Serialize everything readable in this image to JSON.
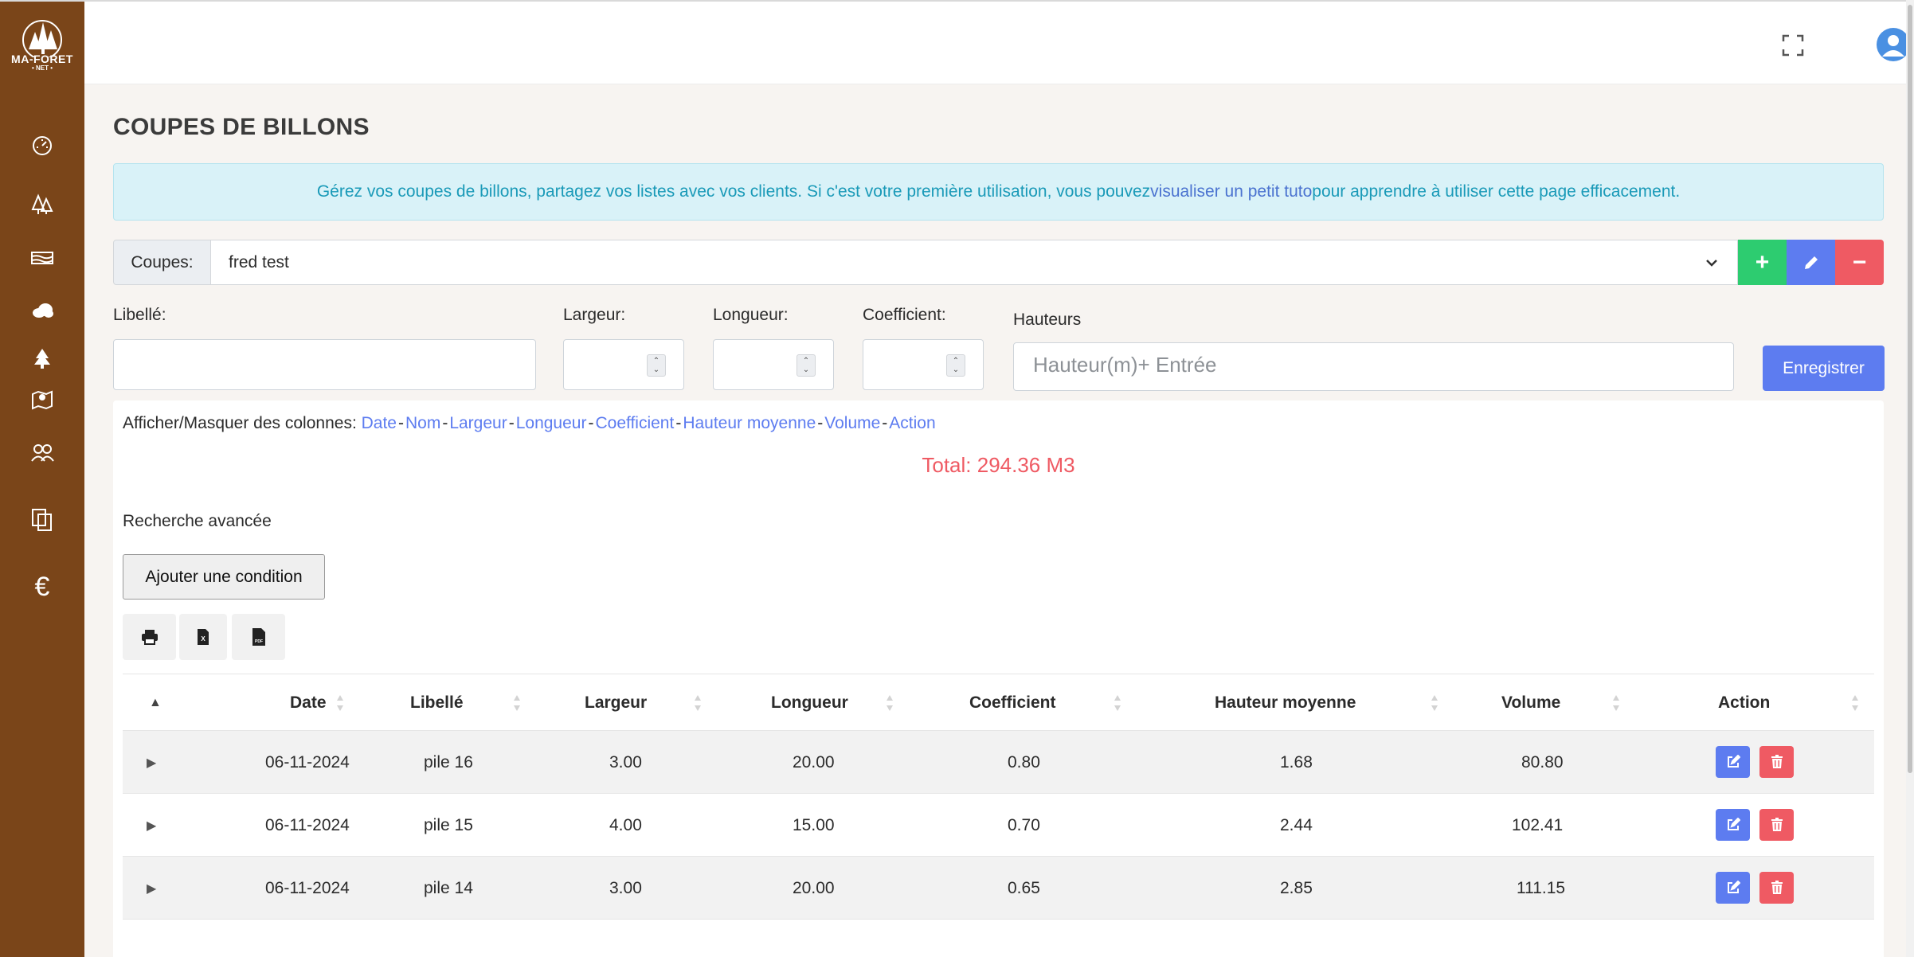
{
  "brand": {
    "logo_text": "MA-FORET",
    "logo_sub": "• NET •"
  },
  "sidebar": {
    "items": [
      {
        "icon": "dashboard-gauge-icon"
      },
      {
        "icon": "trees-icon"
      },
      {
        "icon": "wood-log-icon"
      },
      {
        "icon": "cloud-icon"
      },
      {
        "icon": "tree-icon"
      },
      {
        "icon": "map-marker-icon"
      },
      {
        "icon": "users-icon"
      },
      {
        "icon": "copy-icon"
      },
      {
        "icon": "euro-icon",
        "glyph": "€"
      }
    ]
  },
  "page": {
    "title": "COUPES DE BILLONS"
  },
  "info": {
    "before": "Gérez vos coupes de billons, partagez vos listes avec vos clients. Si c'est votre première utilisation, vous pouvez ",
    "link": "visualiser un petit tuto",
    "after": " pour apprendre à utiliser cette page efficacement."
  },
  "coupes": {
    "label": "Coupes:",
    "selected": "fred test",
    "add": "+",
    "remove": "−"
  },
  "form": {
    "libelle_label": "Libellé:",
    "largeur_label": "Largeur:",
    "longueur_label": "Longueur:",
    "coefficient_label": "Coefficient:",
    "hauteurs_label": "Hauteurs",
    "hauteurs_placeholder": "Hauteur(m)+ Entrée",
    "save": "Enregistrer"
  },
  "columns_toggle": {
    "label": "Afficher/Masquer des colonnes:",
    "items": [
      "Date",
      "Nom",
      "Largeur",
      "Longueur",
      "Coefficient",
      "Hauteur moyenne",
      "Volume",
      "Action"
    ]
  },
  "total": "Total: 294.36 M3",
  "advanced": {
    "label": "Recherche avancée",
    "add_condition": "Ajouter une condition"
  },
  "export": [
    "print-icon",
    "excel-file-icon",
    "pdf-file-icon"
  ],
  "table": {
    "sort_glyph": "▲",
    "headers": [
      "Date",
      "Libellé",
      "Largeur",
      "Longueur",
      "Coefficient",
      "Hauteur moyenne",
      "Volume",
      "Action"
    ],
    "rows": [
      {
        "expand": "▶",
        "date": "06-11-2024",
        "libelle": "pile 16",
        "largeur": "3.00",
        "longueur": "20.00",
        "coefficient": "0.80",
        "hauteur": "1.68",
        "volume": "80.80"
      },
      {
        "expand": "▶",
        "date": "06-11-2024",
        "libelle": "pile 15",
        "largeur": "4.00",
        "longueur": "15.00",
        "coefficient": "0.70",
        "hauteur": "2.44",
        "volume": "102.41"
      },
      {
        "expand": "▶",
        "date": "06-11-2024",
        "libelle": "pile 14",
        "largeur": "3.00",
        "longueur": "20.00",
        "coefficient": "0.65",
        "hauteur": "2.85",
        "volume": "111.15"
      }
    ]
  },
  "colors": {
    "sidebar": "#7a4519",
    "primary": "#5d7cf0",
    "success": "#2dcc70",
    "danger": "#ef5a63",
    "info_text": "#1a9ab8",
    "info_bg": "#d9f2f8"
  }
}
